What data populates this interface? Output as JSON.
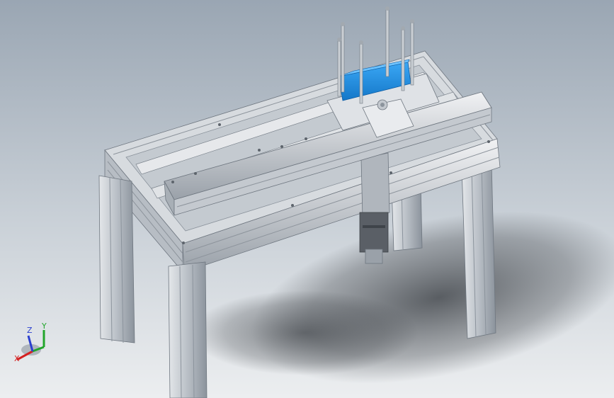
{
  "viewport": {
    "background_top": "#9aa6b3",
    "background_bottom": "#e9ecef",
    "frame_color": "#c9ced3",
    "frame_dark": "#7d8590",
    "accent_part_color": "#1e8fe6",
    "motor_color": "#5a5f66",
    "shadow_color": "#3d4146"
  },
  "triad": {
    "x_label": "X",
    "y_label": "Y",
    "z_label": "Z",
    "x_color": "#d42020",
    "y_color": "#22a52b",
    "z_color": "#2a3fcf"
  }
}
